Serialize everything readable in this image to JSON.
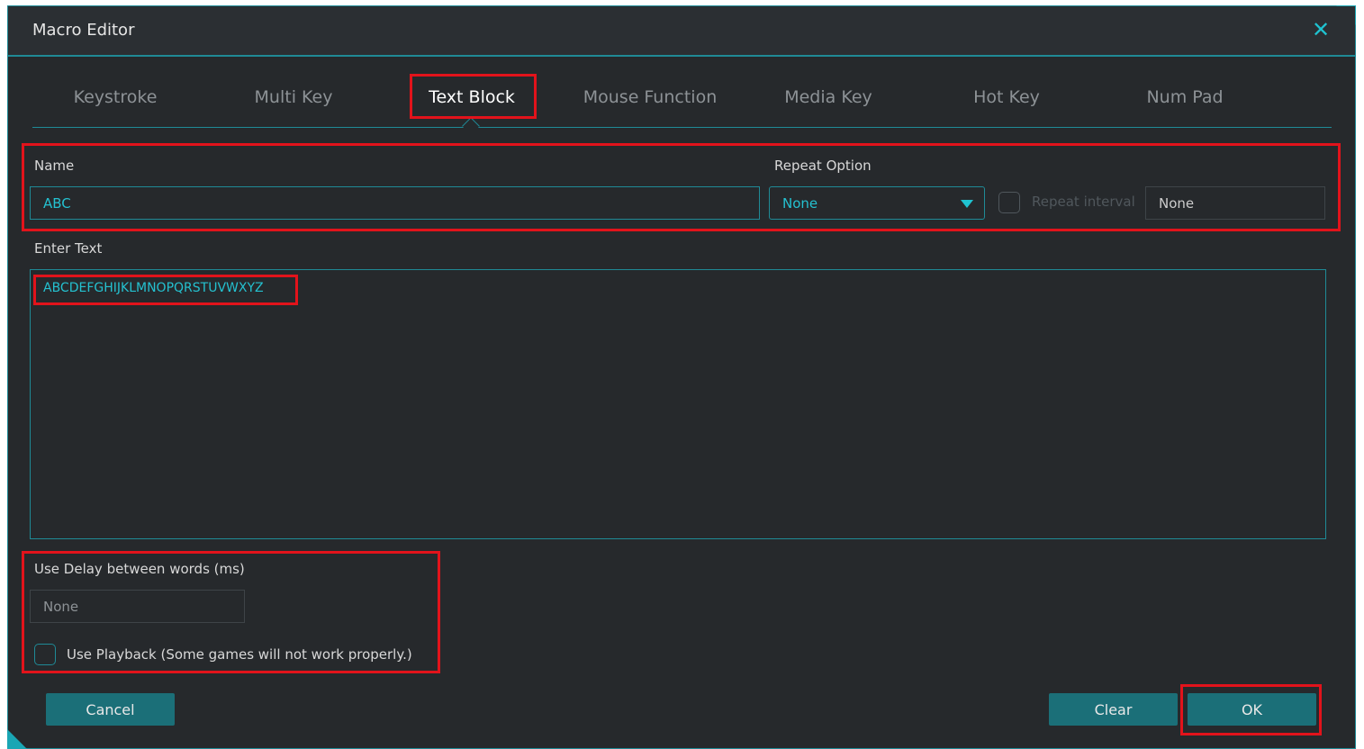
{
  "window": {
    "title": "Macro Editor"
  },
  "tabs": [
    {
      "label": "Keystroke"
    },
    {
      "label": "Multi Key"
    },
    {
      "label": "Text Block"
    },
    {
      "label": "Mouse Function"
    },
    {
      "label": "Media Key"
    },
    {
      "label": "Hot Key"
    },
    {
      "label": "Num Pad"
    }
  ],
  "active_tab": "Text Block",
  "name_section": {
    "label": "Name",
    "value": "ABC"
  },
  "repeat_section": {
    "label": "Repeat Option",
    "selected": "None",
    "interval_label": "Repeat interval",
    "interval_value": "None"
  },
  "text_section": {
    "label": "Enter Text",
    "value": "ABCDEFGHIJKLMNOPQRSTUVWXYZ"
  },
  "delay_section": {
    "label": "Use Delay between words (ms)",
    "value": "None"
  },
  "playback": {
    "label": "Use Playback (Some games will not work properly.)"
  },
  "buttons": {
    "cancel": "Cancel",
    "clear": "Clear",
    "ok": "OK"
  },
  "colors": {
    "accent": "#1f8a96",
    "accent_text": "#24c1d0",
    "button": "#1b6f78",
    "background": "#26292c",
    "highlight": "#e2131b"
  }
}
